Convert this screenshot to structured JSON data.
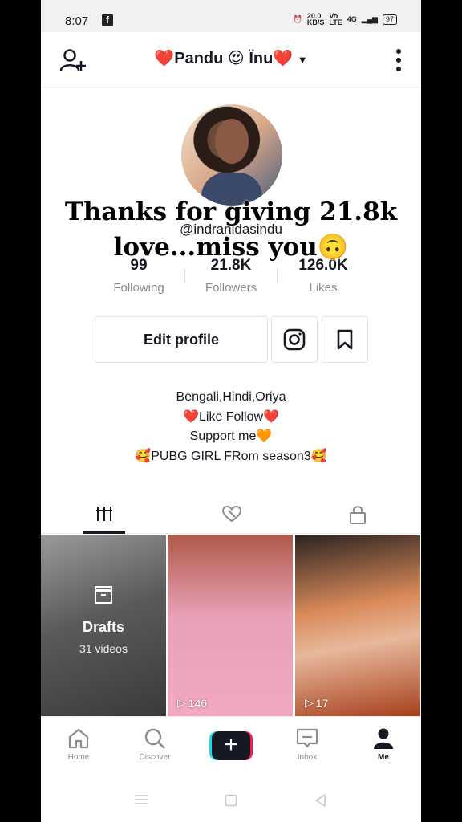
{
  "status": {
    "time": "8:07",
    "fb_icon": "f",
    "net_speed": "20.0\nKB/S",
    "net_type": "Vo\nLTE",
    "signal": "4G",
    "battery": "97"
  },
  "header": {
    "username": "❤️Pandu 😍 Ïnu❤️",
    "menu_icon": "kebab-icon",
    "add_user_icon": "add-user-icon"
  },
  "profile": {
    "handle": "@indranidasindu",
    "overlay_text": "Thanks for giving 21.8k\nlove...miss you🙃",
    "stats": [
      {
        "value": "99",
        "label": "Following"
      },
      {
        "value": "21.8K",
        "label": "Followers"
      },
      {
        "value": "126.0K",
        "label": "Likes"
      }
    ],
    "edit_label": "Edit profile",
    "bio": [
      "Bengali,Hindi,Oriya",
      "❤️Like Follow❤️",
      "Support me🧡",
      "🥰PUBG GIRL FRom season3🥰"
    ]
  },
  "tabs": [
    {
      "name": "videos",
      "icon": "grid-icon",
      "active": true
    },
    {
      "name": "liked",
      "icon": "liked-icon",
      "active": false
    },
    {
      "name": "private",
      "icon": "lock-icon",
      "active": false
    }
  ],
  "grid": {
    "drafts_title": "Drafts",
    "drafts_count": "31 videos",
    "views": [
      "146",
      "17"
    ]
  },
  "nav": [
    {
      "label": "Home",
      "icon": "home-icon"
    },
    {
      "label": "Discover",
      "icon": "search-icon"
    },
    {
      "label": "",
      "icon": "create-icon"
    },
    {
      "label": "Inbox",
      "icon": "inbox-icon"
    },
    {
      "label": "Me",
      "icon": "profile-icon"
    }
  ]
}
